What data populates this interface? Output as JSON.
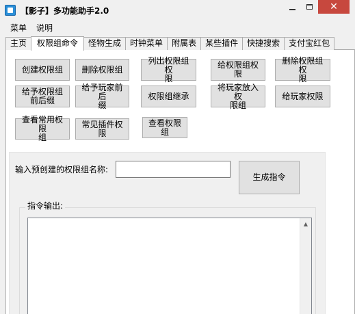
{
  "window": {
    "title": "【影子】多功能助手2.0",
    "minimize": "",
    "maximize": "",
    "close": "✕"
  },
  "menu": [
    "菜单",
    "说明"
  ],
  "tabs": [
    {
      "label": "主页",
      "active": false
    },
    {
      "label": "权限组命令",
      "active": true
    },
    {
      "label": "怪物生成",
      "active": false
    },
    {
      "label": "时钟菜单",
      "active": false
    },
    {
      "label": "附属表",
      "active": false
    },
    {
      "label": "某些插件",
      "active": false
    },
    {
      "label": "快捷搜索",
      "active": false
    },
    {
      "label": "支付宝红包",
      "active": false
    }
  ],
  "buttons": {
    "create_group": [
      "创建权限组"
    ],
    "delete_group": [
      "删除权限组"
    ],
    "list_group_perms": [
      "列出权限组权",
      "限"
    ],
    "give_group_perm": [
      "给权限组权限"
    ],
    "delete_group_perm": [
      "删除权限组权",
      "限"
    ],
    "give_group_prefix": [
      "给予权限组",
      "前后缀"
    ],
    "give_player_prefix": [
      "给予玩家前后",
      "缀"
    ],
    "group_inherit": [
      "权限组继承"
    ],
    "add_player_to_group": [
      "将玩家放入权",
      "限组"
    ],
    "give_player_perm": [
      "给玩家权限"
    ],
    "view_common_groups": [
      "查看常用权限",
      "组"
    ],
    "common_plugin_perms": [
      "常见插件权限"
    ],
    "view_groups": [
      "查看权限组"
    ],
    "generate": [
      "生成指令"
    ]
  },
  "form": {
    "name_label": "输入预创建的权限组名称:",
    "name_value": "",
    "output_label": "指令输出:",
    "output_value": ""
  }
}
